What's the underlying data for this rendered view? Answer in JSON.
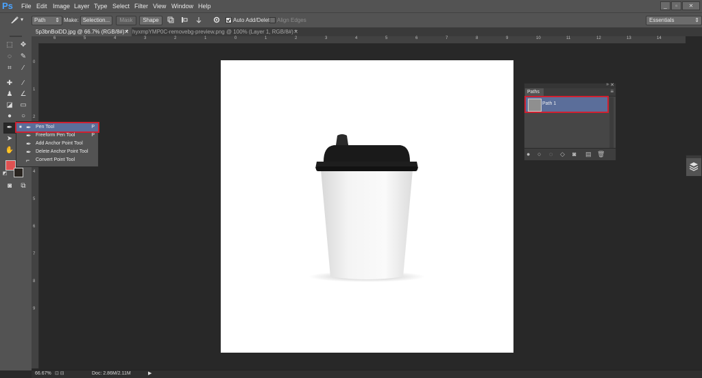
{
  "app": {
    "logo": "Ps"
  },
  "menu": [
    "File",
    "Edit",
    "Image",
    "Layer",
    "Type",
    "Select",
    "Filter",
    "View",
    "Window",
    "Help"
  ],
  "window_controls": [
    "_",
    "▫",
    "✕"
  ],
  "options": {
    "mode_value": "Path",
    "make_label": "Make:",
    "selection_btn": "Selection...",
    "mask_btn": "Mask",
    "shape_btn": "Shape",
    "auto_add_delete": "Auto Add/Delete",
    "align_edges": "Align Edges",
    "workspace": "Essentials"
  },
  "tabs": [
    {
      "label": "5p3bnBoiDD.jpg @ 66.7% (RGB/8#) *",
      "active": true
    },
    {
      "label": "hyxmpYMP0C-removebg-preview.png @ 100% (Layer 1, RGB/8#) *",
      "active": false
    }
  ],
  "ruler_top_ticks": [
    "6",
    "5",
    "4",
    "3",
    "2",
    "1",
    "0",
    "1",
    "2",
    "3",
    "4",
    "5",
    "6",
    "7",
    "8",
    "9",
    "10",
    "11",
    "12",
    "13",
    "14"
  ],
  "ruler_left_ticks": [
    "0",
    "1",
    "2",
    "3",
    "4",
    "5",
    "6",
    "7",
    "8",
    "9"
  ],
  "flyout": [
    {
      "label": "Pen Tool",
      "key": "P",
      "icon": "pen-icon"
    },
    {
      "label": "Freeform Pen Tool",
      "key": "P",
      "icon": "freeform-pen-icon"
    },
    {
      "label": "Add Anchor Point Tool",
      "key": "",
      "icon": "add-anchor-icon"
    },
    {
      "label": "Delete Anchor Point Tool",
      "key": "",
      "icon": "delete-anchor-icon"
    },
    {
      "label": "Convert Point Tool",
      "key": "",
      "icon": "convert-point-icon"
    }
  ],
  "paths_panel": {
    "title": "Paths",
    "item": "Path 1"
  },
  "status": {
    "zoom": "66.67%",
    "doc": "Doc: 2.86M/2.11M"
  },
  "colors": {
    "foreground": "#e05252",
    "background": "#2a2520",
    "highlight": "#d02030",
    "selection": "#5b6e9a"
  }
}
